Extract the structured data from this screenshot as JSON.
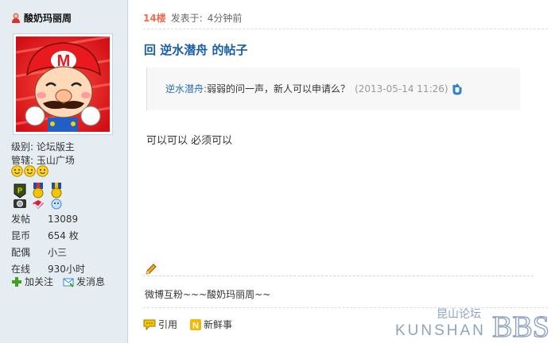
{
  "author": {
    "name": "酸奶玛丽周",
    "level_label": "级别:",
    "level_value": "论坛版主",
    "manage_label": "管辖:",
    "manage_value": "玉山广场"
  },
  "stats": [
    {
      "label": "发帖",
      "value": "13089"
    },
    {
      "label": "昆币",
      "value": "654 枚"
    },
    {
      "label": "配偶",
      "value": "小三"
    },
    {
      "label": "在线",
      "value": "930小时"
    }
  ],
  "sidebar_actions": {
    "follow": "加关注",
    "message": "发消息"
  },
  "post": {
    "floor": "14楼",
    "posted_prefix": "发表于:",
    "posted_time": "4分钟前",
    "title": "回 逆水潜舟 的帖子",
    "quote_user": "逆水潜舟:",
    "quote_text": "弱弱的问一声，新人可以申请么？",
    "quote_time": "(2013-05-14 11:26)",
    "content": "可以可以 必须可以",
    "signature": "微博互粉~~~酸奶玛丽周~~"
  },
  "post_actions": {
    "quote": "引用",
    "fresh": "新鲜事"
  },
  "watermark": {
    "cn": "昆山论坛",
    "en": "KUNSHAN",
    "bbs": "BBS"
  },
  "colors": {
    "sidebar_bg": "#e5edf2",
    "floor": "#f26c4f",
    "title": "#1a5da7",
    "quote_user": "#2b6fb6"
  }
}
